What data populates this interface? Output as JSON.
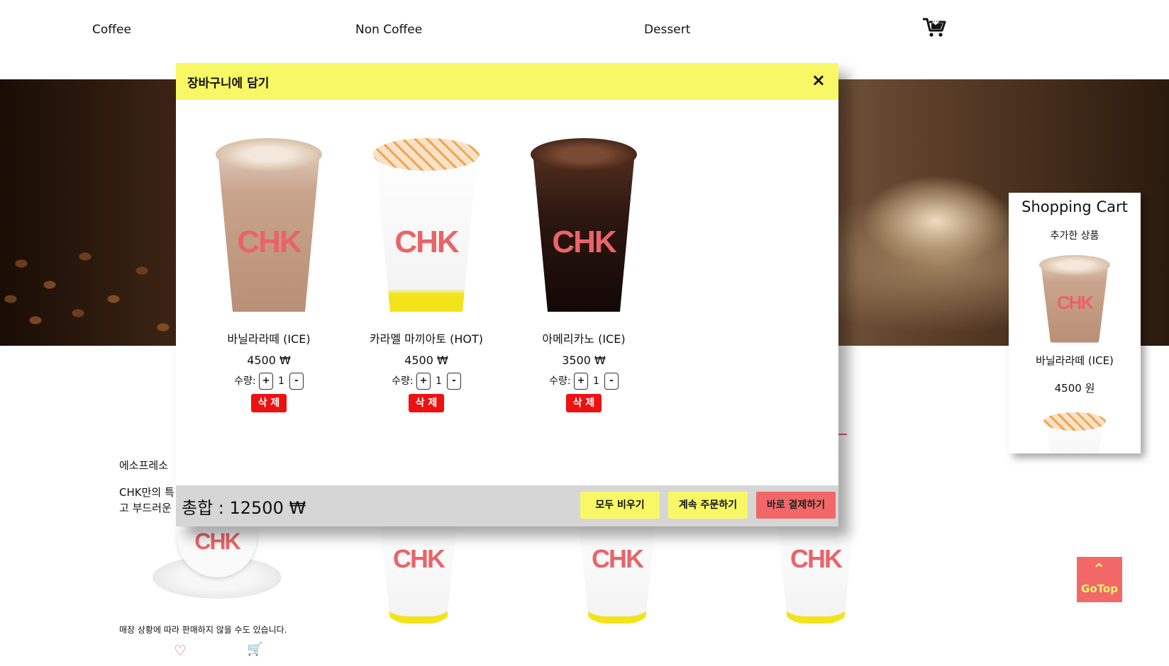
{
  "nav": {
    "items": [
      "Coffee",
      "Non Coffee",
      "Dessert"
    ],
    "cart_icon": "cart-icon"
  },
  "background": {
    "heading": "에소프레소",
    "desc_line1": "CHK만의 특",
    "desc_line2": "고 부드러운 !",
    "note": "매장 상황에 따라 판매하지 않을 수도 있습니다.",
    "logo_text": "CHK",
    "heart_icon": "♡",
    "cart_icon": "🛒"
  },
  "modal": {
    "title": "장바구니에 담기",
    "close": "×",
    "qty_label": "수량:",
    "plus": "+",
    "minus": "-",
    "delete_label": "삭 제",
    "logo_text": "CHK",
    "items": [
      {
        "name": "바닐라라떼 (ICE)",
        "price": "4500 ₩",
        "qty": "1",
        "type": "latte-ice"
      },
      {
        "name": "카라멜 마끼아토 (HOT)",
        "price": "4500 ₩",
        "qty": "1",
        "type": "caramel-hot"
      },
      {
        "name": "아메리카노 (ICE)",
        "price": "3500 ₩",
        "qty": "1",
        "type": "americano-ice"
      }
    ],
    "total_label": "총합 : 12500 ₩",
    "buttons": {
      "clear": "모두 비우기",
      "continue": "계속 주문하기",
      "checkout": "바로 결제하기"
    }
  },
  "sidecart": {
    "title": "Shopping Cart",
    "subtitle": "추가한 상품",
    "item_name": "바닐라라떼 (ICE)",
    "item_price": "4500 원",
    "logo_text": "CHK"
  },
  "gotop": {
    "label": "GoTop",
    "arrow": "⌃"
  },
  "colors": {
    "yellow": "#f8f866",
    "red": "#ee1111",
    "coral": "#f26868",
    "logo": "#e96469"
  }
}
